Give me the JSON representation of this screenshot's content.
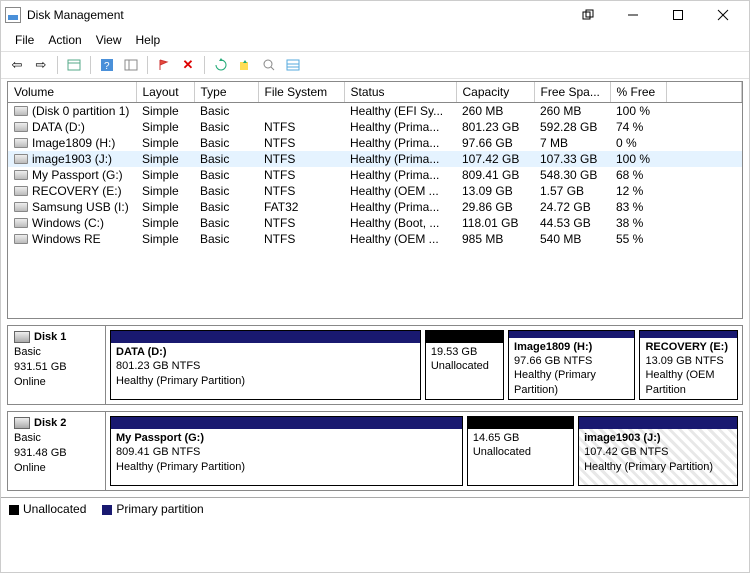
{
  "window": {
    "title": "Disk Management"
  },
  "menus": {
    "file": "File",
    "action": "Action",
    "view": "View",
    "help": "Help"
  },
  "columns": {
    "volume": "Volume",
    "layout": "Layout",
    "type": "Type",
    "fs": "File System",
    "status": "Status",
    "capacity": "Capacity",
    "free": "Free Spa...",
    "pct": "% Free"
  },
  "vols": [
    {
      "name": "(Disk 0 partition 1)",
      "layout": "Simple",
      "type": "Basic",
      "fs": "",
      "status": "Healthy (EFI Sy...",
      "cap": "260 MB",
      "free": "260 MB",
      "pct": "100 %"
    },
    {
      "name": "DATA (D:)",
      "layout": "Simple",
      "type": "Basic",
      "fs": "NTFS",
      "status": "Healthy (Prima...",
      "cap": "801.23 GB",
      "free": "592.28 GB",
      "pct": "74 %"
    },
    {
      "name": "Image1809 (H:)",
      "layout": "Simple",
      "type": "Basic",
      "fs": "NTFS",
      "status": "Healthy (Prima...",
      "cap": "97.66 GB",
      "free": "7 MB",
      "pct": "0 %"
    },
    {
      "name": "image1903 (J:)",
      "layout": "Simple",
      "type": "Basic",
      "fs": "NTFS",
      "status": "Healthy (Prima...",
      "cap": "107.42 GB",
      "free": "107.33 GB",
      "pct": "100 %"
    },
    {
      "name": "My Passport (G:)",
      "layout": "Simple",
      "type": "Basic",
      "fs": "NTFS",
      "status": "Healthy (Prima...",
      "cap": "809.41 GB",
      "free": "548.30 GB",
      "pct": "68 %"
    },
    {
      "name": "RECOVERY (E:)",
      "layout": "Simple",
      "type": "Basic",
      "fs": "NTFS",
      "status": "Healthy (OEM ...",
      "cap": "13.09 GB",
      "free": "1.57 GB",
      "pct": "12 %"
    },
    {
      "name": "Samsung USB (I:)",
      "layout": "Simple",
      "type": "Basic",
      "fs": "FAT32",
      "status": "Healthy (Prima...",
      "cap": "29.86 GB",
      "free": "24.72 GB",
      "pct": "83 %"
    },
    {
      "name": "Windows (C:)",
      "layout": "Simple",
      "type": "Basic",
      "fs": "NTFS",
      "status": "Healthy (Boot, ...",
      "cap": "118.01 GB",
      "free": "44.53 GB",
      "pct": "38 %"
    },
    {
      "name": "Windows RE",
      "layout": "Simple",
      "type": "Basic",
      "fs": "NTFS",
      "status": "Healthy (OEM ...",
      "cap": "985 MB",
      "free": "540 MB",
      "pct": "55 %"
    }
  ],
  "selected_index": 3,
  "disks": [
    {
      "label": "Disk 1",
      "type": "Basic",
      "size": "931.51 GB",
      "state": "Online",
      "parts": [
        {
          "kind": "primary",
          "name": "DATA  (D:)",
          "line2": "801.23 GB NTFS",
          "line3": "Healthy (Primary Partition)",
          "flex": 32,
          "hatch": false
        },
        {
          "kind": "unalloc",
          "name": "",
          "line2": "19.53 GB",
          "line3": "Unallocated",
          "flex": 8,
          "hatch": false
        },
        {
          "kind": "primary",
          "name": "Image1809  (H:)",
          "line2": "97.66 GB NTFS",
          "line3": "Healthy (Primary Partition)",
          "flex": 13,
          "hatch": false
        },
        {
          "kind": "primary",
          "name": "RECOVERY  (E:)",
          "line2": "13.09 GB NTFS",
          "line3": "Healthy (OEM Partition",
          "flex": 10,
          "hatch": false
        }
      ]
    },
    {
      "label": "Disk 2",
      "type": "Basic",
      "size": "931.48 GB",
      "state": "Online",
      "parts": [
        {
          "kind": "primary",
          "name": "My Passport  (G:)",
          "line2": "809.41 GB NTFS",
          "line3": "Healthy (Primary Partition)",
          "flex": 40,
          "hatch": false
        },
        {
          "kind": "unalloc",
          "name": "",
          "line2": "14.65 GB",
          "line3": "Unallocated",
          "flex": 12,
          "hatch": false
        },
        {
          "kind": "primary",
          "name": "image1903  (J:)",
          "line2": "107.42 GB NTFS",
          "line3": "Healthy (Primary Partition)",
          "flex": 18,
          "hatch": true
        }
      ]
    }
  ],
  "legend": {
    "unalloc": "Unallocated",
    "primary": "Primary partition"
  }
}
